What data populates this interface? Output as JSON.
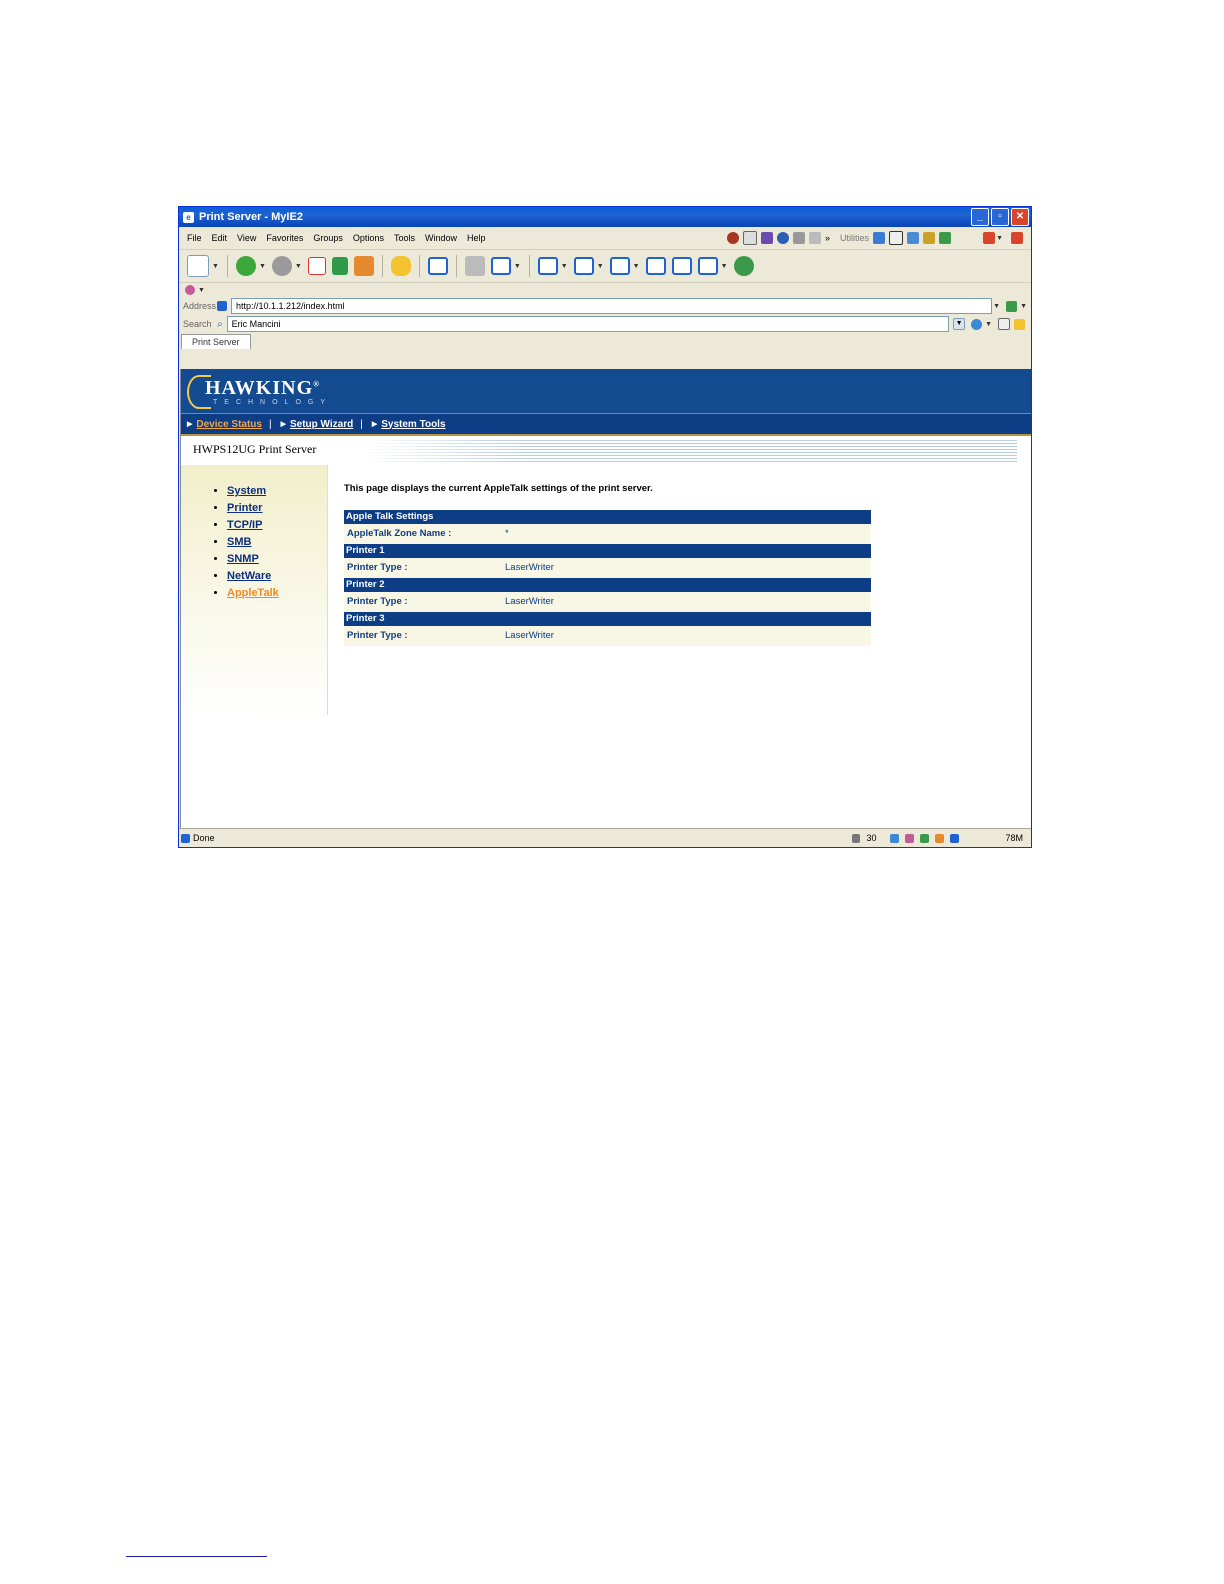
{
  "window": {
    "title": "Print Server - MyIE2"
  },
  "menu": [
    "File",
    "Edit",
    "View",
    "Favorites",
    "Groups",
    "Options",
    "Tools",
    "Window",
    "Help"
  ],
  "menu_extra": {
    "chevron": "»",
    "utilities": "Utilities"
  },
  "address": {
    "label": "Address",
    "url": "http://10.1.1.212/index.html"
  },
  "search": {
    "label": "Search",
    "value": "Eric Mancini"
  },
  "tab": {
    "label": "Print Server"
  },
  "banner": {
    "logo": "HAWKING",
    "trademark": "®",
    "tagline": "TECHNOLOGY"
  },
  "nav": [
    {
      "label": "Device Status"
    },
    {
      "label": "Setup Wizard"
    },
    {
      "label": "System Tools"
    }
  ],
  "device_title": "HWPS12UG Print Server",
  "sidebar": [
    "System",
    "Printer",
    "TCP/IP",
    "SMB",
    "SNMP",
    "NetWare",
    "AppleTalk"
  ],
  "content": {
    "intro": "This page displays the current AppleTalk settings of the print server.",
    "sections": [
      {
        "header": "Apple Talk Settings",
        "key": "AppleTalk Zone Name :",
        "value": "*"
      },
      {
        "header": "Printer 1",
        "key": "Printer Type :",
        "value": "LaserWriter"
      },
      {
        "header": "Printer 2",
        "key": "Printer Type :",
        "value": "LaserWriter"
      },
      {
        "header": "Printer 3",
        "key": "Printer Type :",
        "value": "LaserWriter"
      }
    ]
  },
  "status": {
    "text": "Done",
    "count": "30",
    "memory": "78M"
  },
  "colors": {
    "banner": "#144a8f",
    "nav": "#0d3d85",
    "active_link": "#f08a1e",
    "link": "#0b2f7a"
  }
}
